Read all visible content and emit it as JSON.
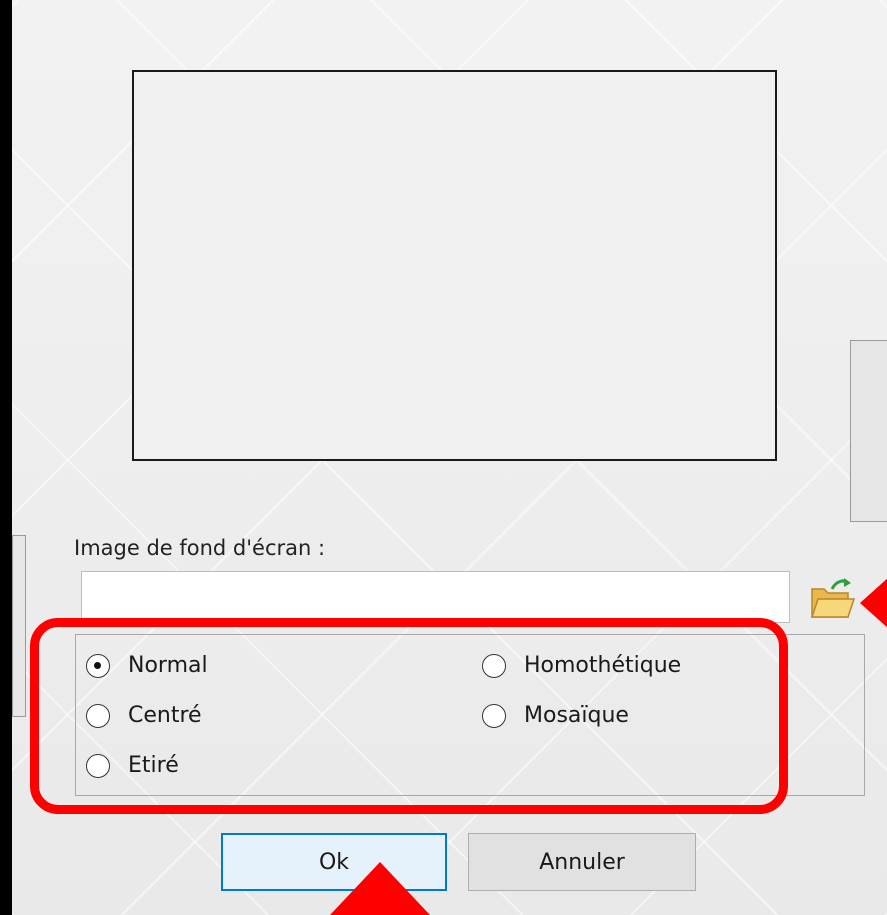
{
  "dialog": {
    "path_label": "Image de fond d'écran :",
    "path_value": "",
    "folder_icon": "folder-open-icon"
  },
  "options": [
    {
      "label": "Normal",
      "selected": true
    },
    {
      "label": "Centré",
      "selected": false
    },
    {
      "label": "Etiré",
      "selected": false
    },
    {
      "label": "Homothétique",
      "selected": false
    },
    {
      "label": "Mosaïque",
      "selected": false
    }
  ],
  "buttons": {
    "ok_label": "Ok",
    "cancel_label": "Annuler"
  },
  "colors": {
    "highlight": "#ff0000",
    "accent": "#0078d7"
  }
}
